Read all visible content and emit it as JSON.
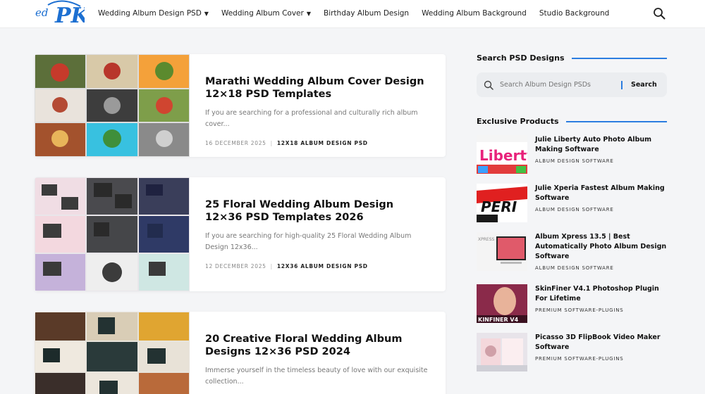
{
  "header": {
    "logo_text": "PK",
    "nav": [
      {
        "label": "Wedding Album Design PSD",
        "dropdown": true
      },
      {
        "label": "Wedding Album Cover",
        "dropdown": true
      },
      {
        "label": "Birthday Album Design",
        "dropdown": false
      },
      {
        "label": "Wedding Album Background",
        "dropdown": false
      },
      {
        "label": "Studio Background",
        "dropdown": false
      }
    ],
    "search_icon": "search-icon"
  },
  "posts": [
    {
      "title": "Marathi Wedding Album Cover Design 12×18 PSD Templates",
      "excerpt": "If you are searching for a professional and culturally rich album cover...",
      "date": "16 DECEMBER 2025",
      "category": "12X18 ALBUM DESIGN PSD"
    },
    {
      "title": "25 Floral Wedding Album Design 12×36 PSD Templates 2026",
      "excerpt": "If you are searching for high-quality 25 Floral Wedding Album Design 12x36...",
      "date": "12 DECEMBER 2025",
      "category": "12X36 ALBUM DESIGN PSD"
    },
    {
      "title": "20 Creative Floral Wedding Album Designs 12×36 PSD 2024",
      "excerpt": "Immerse yourself in the timeless beauty of love with our exquisite collection...",
      "date": "",
      "category": ""
    }
  ],
  "sidebar": {
    "search_heading": "Search PSD Designs",
    "search_placeholder": "Search Album Design PSDs",
    "search_button": "Search",
    "products_heading": "Exclusive Products",
    "products": [
      {
        "title": "Julie Liberty Auto Photo Album Making Software",
        "category": "ALBUM DESIGN SOFTWARE",
        "thumb_text": "Liberty"
      },
      {
        "title": "Julie Xperia Fastest Album Making Software",
        "category": "ALBUM DESIGN SOFTWARE",
        "thumb_text": "PERI"
      },
      {
        "title": "Album Xpress 13.5 | Best Automatically Photo Album Design Software",
        "category": "ALBUM DESIGN SOFTWARE",
        "thumb_text": "XPRESS"
      },
      {
        "title": "SkinFiner V4.1 Photoshop Plugin For Lifetime",
        "category": "PREMIUM SOFTWARE-PLUGINS",
        "thumb_text": "KINFINER V4"
      },
      {
        "title": "Picasso 3D FlipBook Video Maker Software",
        "category": "PREMIUM SOFTWARE-PLUGINS",
        "thumb_text": ""
      }
    ]
  },
  "colors": {
    "accent": "#2b7de0",
    "background": "#f4f5f7"
  }
}
